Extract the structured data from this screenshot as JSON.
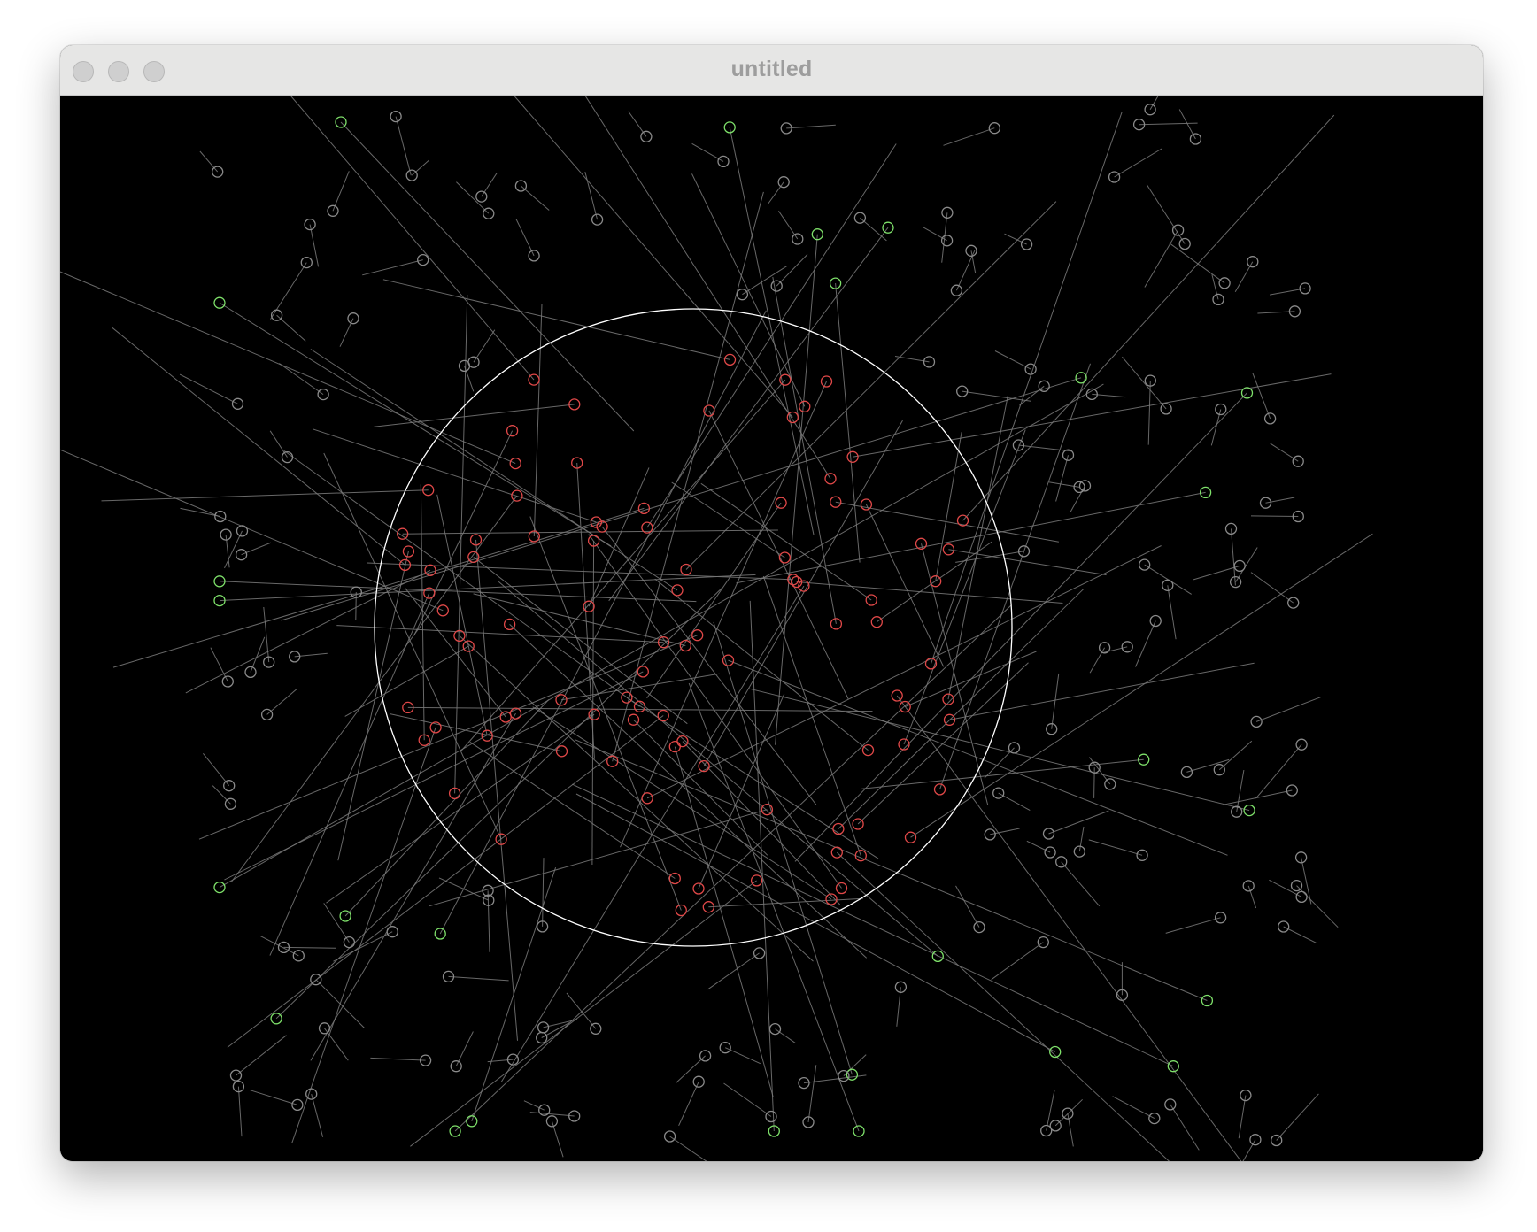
{
  "window": {
    "title": "untitled",
    "buttons": [
      "close",
      "minimize",
      "zoom"
    ]
  },
  "sketch": {
    "background": "#000000",
    "boundary": {
      "stroke": "#ffffff",
      "shape": "circle"
    },
    "colors": {
      "inside": "#e04848",
      "outside_crossing": "#7ee06a",
      "outside": "#8a8a8a",
      "line": "#7a7a7a"
    }
  }
}
